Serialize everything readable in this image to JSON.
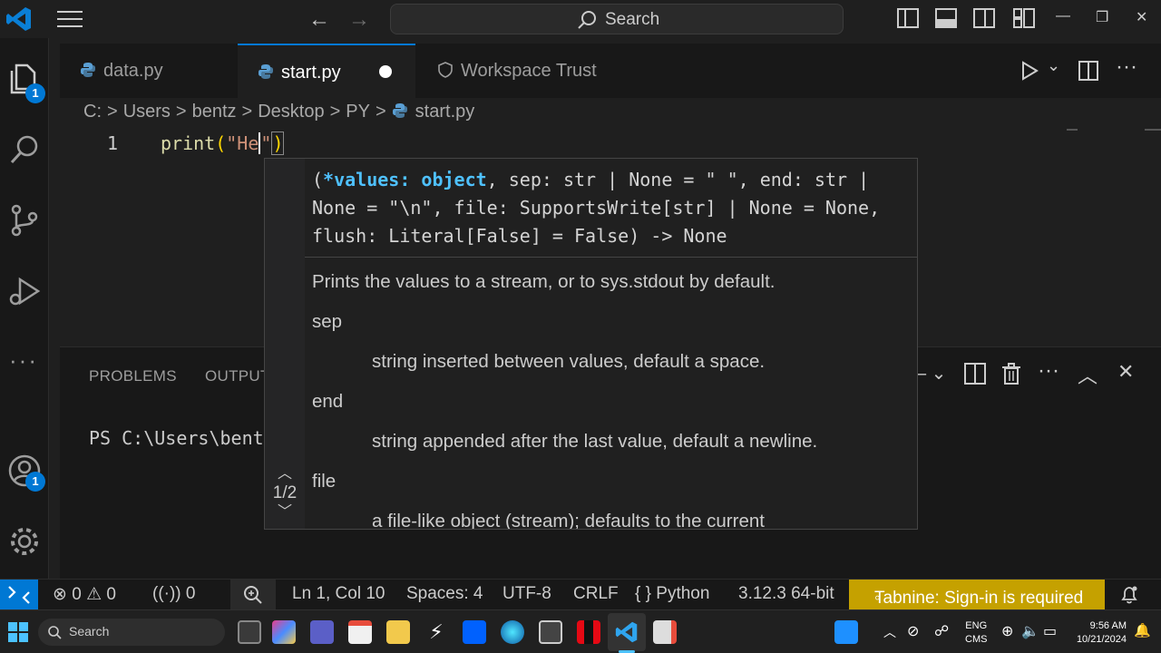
{
  "titlebar": {
    "search_text": "Search"
  },
  "activity": {
    "explorer_badge": "1",
    "account_badge": "1"
  },
  "tabs": [
    {
      "label": "data.py"
    },
    {
      "label": "start.py"
    },
    {
      "label": "Workspace Trust"
    }
  ],
  "breadcrumb": {
    "parts": [
      "C:",
      "Users",
      "bentz",
      "Desktop",
      "PY"
    ],
    "file": "start.py"
  },
  "editor": {
    "line_number": "1",
    "code_fn": "print",
    "code_open": "(",
    "code_str": "\"He",
    "code_str_end": "\"",
    "code_close": ")"
  },
  "hover": {
    "sig_open": "(",
    "sig_param": "*values: object",
    "sig_rest_1": ", sep: str | None = \" \", end: str |",
    "sig_line_2": "None = \"\\n\", file: SupportsWrite[str] | None = None,",
    "sig_line_3": "flush: Literal[False] = False) -> None",
    "doc_summary": "Prints the values to a stream, or to sys.stdout by default.",
    "param_sep": "sep",
    "desc_sep": "string inserted between values, default a space.",
    "param_end": "end",
    "desc_end": "string appended after the last value, default a newline.",
    "param_file": "file",
    "desc_file": "a file-like object (stream); defaults to the current",
    "nav_counter": "1/2"
  },
  "panel": {
    "tab_problems": "PROBLEMS",
    "tab_output": "OUTPUT",
    "terminal_text": "PS C:\\Users\\bent"
  },
  "status": {
    "errors": "0",
    "warnings": "0",
    "ports": "0",
    "position": "Ln 1, Col 10",
    "spaces": "Spaces: 4",
    "encoding": "UTF-8",
    "eol": "CRLF",
    "language": "Python",
    "interpreter": "3.12.3 64-bit",
    "tabnine": "Tabnine: Sign-in is required"
  },
  "taskbar": {
    "search": "Search",
    "lang_1": "ENG",
    "lang_2": "CMS",
    "time": "9:56 AM",
    "date": "10/21/2024"
  },
  "colors": {
    "accent": "#0078d4",
    "tabnine": "#c5a100",
    "string": "#ce9178",
    "function": "#dcdcaa"
  }
}
